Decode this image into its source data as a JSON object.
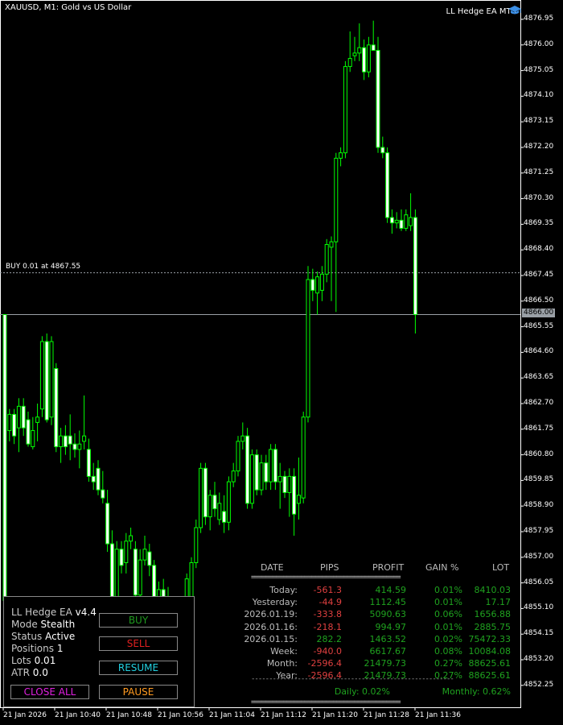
{
  "header": {
    "symbol": "XAUUSD, M1:  Gold vs US Dollar",
    "ea_title": "LL Hedge EA MT5",
    "ea_icon": "graduation-cap-icon"
  },
  "position_line": {
    "label": "BUY 0.01 at 4867.55",
    "price": 4867.55
  },
  "current_price": {
    "label": "4866.00",
    "price": 4866.0
  },
  "price_axis": {
    "labels": [
      "4876.95",
      "4876.00",
      "4875.05",
      "4874.10",
      "4873.15",
      "4872.20",
      "4871.25",
      "4870.30",
      "4869.35",
      "4868.40",
      "4867.45",
      "4866.50",
      "4865.55",
      "4864.60",
      "4863.65",
      "4862.70",
      "4861.75",
      "4860.80",
      "4859.85",
      "4858.90",
      "4857.95",
      "4857.00",
      "4856.05",
      "4855.10",
      "4854.15",
      "4853.20",
      "4852.25"
    ]
  },
  "time_axis": {
    "labels": [
      "21 Jan 2026",
      "21 Jan 10:40",
      "21 Jan 10:48",
      "21 Jan 10:56",
      "21 Jan 11:04",
      "21 Jan 11:12",
      "21 Jan 11:20",
      "21 Jan 11:28",
      "21 Jan 11:36"
    ]
  },
  "colors": {
    "candle": "#00ff00",
    "background": "#000000",
    "grid_line": "#808080",
    "loss": "#e04040",
    "profit": "#1fa21f"
  },
  "panel": {
    "name_label": "LL Hedge EA",
    "version": "v4.4",
    "mode_label": "Mode",
    "mode": "Stealth",
    "status_label": "Status",
    "status": "Active",
    "positions_label": "Positions",
    "positions": "1",
    "lots_label": "Lots",
    "lots": "0.01",
    "atr_label": "ATR",
    "atr": "0.0",
    "buttons": {
      "buy": "BUY",
      "sell": "SELL",
      "resume": "RESUME",
      "close_all": "CLOSE ALL",
      "pause": "PAUSE"
    }
  },
  "stats": {
    "headers": {
      "date": "DATE",
      "pips": "PIPS",
      "profit": "PROFIT",
      "gain": "GAIN %",
      "lot": "LOT"
    },
    "separator": "==========================================",
    "dash_separator": "---------------------------------------------------------",
    "rows": [
      {
        "date": "Today:",
        "pips": "-561.3",
        "profit": "414.59",
        "gain": "0.01%",
        "lot": "8410.03"
      },
      {
        "date": "Yesterday:",
        "pips": "-44.9",
        "profit": "1112.45",
        "gain": "0.01%",
        "lot": "17.17"
      },
      {
        "date": "2026.01.19:",
        "pips": "-333.8",
        "profit": "5090.63",
        "gain": "0.06%",
        "lot": "1656.88"
      },
      {
        "date": "2026.01.16:",
        "pips": "-218.1",
        "profit": "994.97",
        "gain": "0.01%",
        "lot": "2885.75"
      },
      {
        "date": "2026.01.15:",
        "pips": "282.2",
        "profit": "1463.52",
        "gain": "0.02%",
        "lot": "75472.33"
      },
      {
        "date": "Week:",
        "pips": "-940.0",
        "profit": "6617.67",
        "gain": "0.08%",
        "lot": "10084.08"
      },
      {
        "date": "Month:",
        "pips": "-2596.4",
        "profit": "21479.73",
        "gain": "0.27%",
        "lot": "88625.61"
      },
      {
        "date": "Year:",
        "pips": "-2596.4",
        "profit": "21479.73",
        "gain": "0.27%",
        "lot": "88625.61"
      }
    ],
    "daily": "Daily: 0.02%",
    "monthly": "Monthly: 0.62%"
  },
  "chart_data": {
    "type": "candlestick",
    "symbol": "XAUUSD",
    "timeframe": "M1",
    "ylim": [
      4851.7,
      4877.7
    ],
    "candles": [
      {
        "o": 4866.0,
        "h": 4866.0,
        "l": 4855.2,
        "c": 4855.4
      },
      {
        "o": 4861.7,
        "h": 4862.5,
        "l": 4861.3,
        "c": 4862.3
      },
      {
        "o": 4862.3,
        "h": 4862.5,
        "l": 4861.2,
        "c": 4861.5
      },
      {
        "o": 4861.8,
        "h": 4862.9,
        "l": 4860.9,
        "c": 4862.6
      },
      {
        "o": 4862.6,
        "h": 4862.9,
        "l": 4861.5,
        "c": 4861.8
      },
      {
        "o": 4862.1,
        "h": 4862.4,
        "l": 4861.1,
        "c": 4861.2
      },
      {
        "o": 4861.1,
        "h": 4862.2,
        "l": 4861.0,
        "c": 4861.7
      },
      {
        "o": 4862.0,
        "h": 4862.7,
        "l": 4861.3,
        "c": 4862.2
      },
      {
        "o": 4862.5,
        "h": 4865.2,
        "l": 4862.2,
        "c": 4865.0
      },
      {
        "o": 4865.0,
        "h": 4865.3,
        "l": 4862.0,
        "c": 4862.1
      },
      {
        "o": 4862.2,
        "h": 4865.2,
        "l": 4861.9,
        "c": 4865.0
      },
      {
        "o": 4864.0,
        "h": 4864.2,
        "l": 4860.9,
        "c": 4861.1
      },
      {
        "o": 4861.1,
        "h": 4861.8,
        "l": 4860.5,
        "c": 4861.5
      },
      {
        "o": 4861.5,
        "h": 4861.9,
        "l": 4860.8,
        "c": 4861.1
      },
      {
        "o": 4861.5,
        "h": 4862.3,
        "l": 4860.6,
        "c": 4861.2
      },
      {
        "o": 4861.2,
        "h": 4861.6,
        "l": 4860.7,
        "c": 4861.0
      },
      {
        "o": 4861.0,
        "h": 4861.7,
        "l": 4860.3,
        "c": 4861.2
      },
      {
        "o": 4861.3,
        "h": 4863.0,
        "l": 4861.0,
        "c": 4861.5
      },
      {
        "o": 4861.0,
        "h": 4861.4,
        "l": 4859.8,
        "c": 4860.0
      },
      {
        "o": 4860.0,
        "h": 4860.5,
        "l": 4859.5,
        "c": 4859.8
      },
      {
        "o": 4860.3,
        "h": 4860.6,
        "l": 4859.3,
        "c": 4859.5
      },
      {
        "o": 4859.5,
        "h": 4860.2,
        "l": 4859.0,
        "c": 4859.2
      },
      {
        "o": 4859.0,
        "h": 4859.5,
        "l": 4857.2,
        "c": 4857.5
      },
      {
        "o": 4857.5,
        "h": 4858.0,
        "l": 4855.0,
        "c": 4855.3
      },
      {
        "o": 4855.3,
        "h": 4857.6,
        "l": 4855.0,
        "c": 4857.3
      },
      {
        "o": 4857.3,
        "h": 4857.6,
        "l": 4856.4,
        "c": 4856.7
      },
      {
        "o": 4856.8,
        "h": 4857.9,
        "l": 4856.4,
        "c": 4857.6
      },
      {
        "o": 4857.6,
        "h": 4858.1,
        "l": 4857.3,
        "c": 4857.8
      },
      {
        "o": 4857.3,
        "h": 4857.6,
        "l": 4855.4,
        "c": 4855.6
      },
      {
        "o": 4855.6,
        "h": 4857.3,
        "l": 4855.3,
        "c": 4856.9
      },
      {
        "o": 4856.9,
        "h": 4857.8,
        "l": 4856.7,
        "c": 4857.3
      },
      {
        "o": 4857.2,
        "h": 4857.5,
        "l": 4856.3,
        "c": 4856.7
      },
      {
        "o": 4856.7,
        "h": 4856.9,
        "l": 4855.0,
        "c": 4855.3
      },
      {
        "o": 4855.4,
        "h": 4856.1,
        "l": 4855.1,
        "c": 4855.8
      },
      {
        "o": 4855.8,
        "h": 4856.2,
        "l": 4855.2,
        "c": 4855.5
      },
      {
        "o": 4855.5,
        "h": 4855.9,
        "l": 4854.6,
        "c": 4854.8
      },
      {
        "o": 4854.7,
        "h": 4855.2,
        "l": 4854.2,
        "c": 4854.9
      },
      {
        "o": 4854.9,
        "h": 4855.4,
        "l": 4854.0,
        "c": 4854.3
      },
      {
        "o": 4854.3,
        "h": 4855.1,
        "l": 4853.4,
        "c": 4854.8
      },
      {
        "o": 4854.8,
        "h": 4856.4,
        "l": 4854.5,
        "c": 4856.2
      },
      {
        "o": 4855.5,
        "h": 4857.0,
        "l": 4855.3,
        "c": 4856.8
      },
      {
        "o": 4856.8,
        "h": 4858.4,
        "l": 4856.6,
        "c": 4858.1
      },
      {
        "o": 4858.1,
        "h": 4860.5,
        "l": 4857.9,
        "c": 4860.3
      },
      {
        "o": 4860.3,
        "h": 4860.5,
        "l": 4858.2,
        "c": 4858.5
      },
      {
        "o": 4858.5,
        "h": 4859.5,
        "l": 4858.0,
        "c": 4859.3
      },
      {
        "o": 4859.3,
        "h": 4859.8,
        "l": 4858.5,
        "c": 4858.8
      },
      {
        "o": 4858.4,
        "h": 4859.4,
        "l": 4858.2,
        "c": 4859.0
      },
      {
        "o": 4858.7,
        "h": 4859.3,
        "l": 4857.9,
        "c": 4858.3
      },
      {
        "o": 4858.3,
        "h": 4860.0,
        "l": 4858.0,
        "c": 4859.8
      },
      {
        "o": 4859.8,
        "h": 4860.5,
        "l": 4859.6,
        "c": 4860.2
      },
      {
        "o": 4860.2,
        "h": 4861.5,
        "l": 4860.0,
        "c": 4861.3
      },
      {
        "o": 4861.3,
        "h": 4862.0,
        "l": 4861.0,
        "c": 4861.5
      },
      {
        "o": 4861.5,
        "h": 4861.8,
        "l": 4858.8,
        "c": 4859.0
      },
      {
        "o": 4859.0,
        "h": 4861.0,
        "l": 4858.8,
        "c": 4860.8
      },
      {
        "o": 4860.8,
        "h": 4861.0,
        "l": 4859.3,
        "c": 4859.5
      },
      {
        "o": 4859.5,
        "h": 4860.8,
        "l": 4859.3,
        "c": 4860.5
      },
      {
        "o": 4860.5,
        "h": 4860.8,
        "l": 4859.5,
        "c": 4859.8
      },
      {
        "o": 4859.8,
        "h": 4861.2,
        "l": 4859.5,
        "c": 4861.0
      },
      {
        "o": 4861.0,
        "h": 4861.2,
        "l": 4859.5,
        "c": 4859.8
      },
      {
        "o": 4859.8,
        "h": 4860.5,
        "l": 4858.8,
        "c": 4860.0
      },
      {
        "o": 4860.0,
        "h": 4860.2,
        "l": 4859.2,
        "c": 4859.4
      },
      {
        "o": 4859.4,
        "h": 4860.3,
        "l": 4858.5,
        "c": 4860.0
      },
      {
        "o": 4860.0,
        "h": 4860.3,
        "l": 4857.8,
        "c": 4858.6
      },
      {
        "o": 4859.0,
        "h": 4860.7,
        "l": 4858.4,
        "c": 4859.3
      },
      {
        "o": 4859.2,
        "h": 4862.4,
        "l": 4859.0,
        "c": 4862.2
      },
      {
        "o": 4862.2,
        "h": 4867.8,
        "l": 4862.0,
        "c": 4867.3
      },
      {
        "o": 4867.3,
        "h": 4867.7,
        "l": 4866.5,
        "c": 4866.9
      },
      {
        "o": 4866.8,
        "h": 4867.6,
        "l": 4866.0,
        "c": 4867.4
      },
      {
        "o": 4866.9,
        "h": 4867.8,
        "l": 4866.5,
        "c": 4867.5
      },
      {
        "o": 4867.5,
        "h": 4868.8,
        "l": 4867.2,
        "c": 4868.6
      },
      {
        "o": 4868.5,
        "h": 4868.9,
        "l": 4866.5,
        "c": 4868.7
      },
      {
        "o": 4868.7,
        "h": 4872.0,
        "l": 4866.1,
        "c": 4871.8
      },
      {
        "o": 4871.8,
        "h": 4872.2,
        "l": 4871.5,
        "c": 4872.0
      },
      {
        "o": 4872.0,
        "h": 4875.4,
        "l": 4871.8,
        "c": 4875.2
      },
      {
        "o": 4875.2,
        "h": 4876.5,
        "l": 4875.0,
        "c": 4875.5
      },
      {
        "o": 4875.6,
        "h": 4876.3,
        "l": 4875.4,
        "c": 4875.7
      },
      {
        "o": 4875.7,
        "h": 4876.8,
        "l": 4875.4,
        "c": 4875.9
      },
      {
        "o": 4875.9,
        "h": 4876.2,
        "l": 4874.7,
        "c": 4875.0
      },
      {
        "o": 4875.0,
        "h": 4876.3,
        "l": 4874.8,
        "c": 4876.0
      },
      {
        "o": 4876.0,
        "h": 4876.9,
        "l": 4875.8,
        "c": 4875.8
      },
      {
        "o": 4875.8,
        "h": 4876.3,
        "l": 4872.0,
        "c": 4872.2
      },
      {
        "o": 4872.2,
        "h": 4872.6,
        "l": 4871.8,
        "c": 4872.0
      },
      {
        "o": 4872.0,
        "h": 4872.2,
        "l": 4869.4,
        "c": 4869.6
      },
      {
        "o": 4869.6,
        "h": 4869.9,
        "l": 4869.0,
        "c": 4869.4
      },
      {
        "o": 4869.4,
        "h": 4869.8,
        "l": 4869.2,
        "c": 4869.5
      },
      {
        "o": 4869.5,
        "h": 4869.9,
        "l": 4869.1,
        "c": 4869.2
      },
      {
        "o": 4869.2,
        "h": 4869.9,
        "l": 4869.1,
        "c": 4869.7
      },
      {
        "o": 4869.3,
        "h": 4870.5,
        "l": 4869.1,
        "c": 4869.6
      },
      {
        "o": 4869.6,
        "h": 4869.9,
        "l": 4865.3,
        "c": 4866.0
      }
    ]
  }
}
